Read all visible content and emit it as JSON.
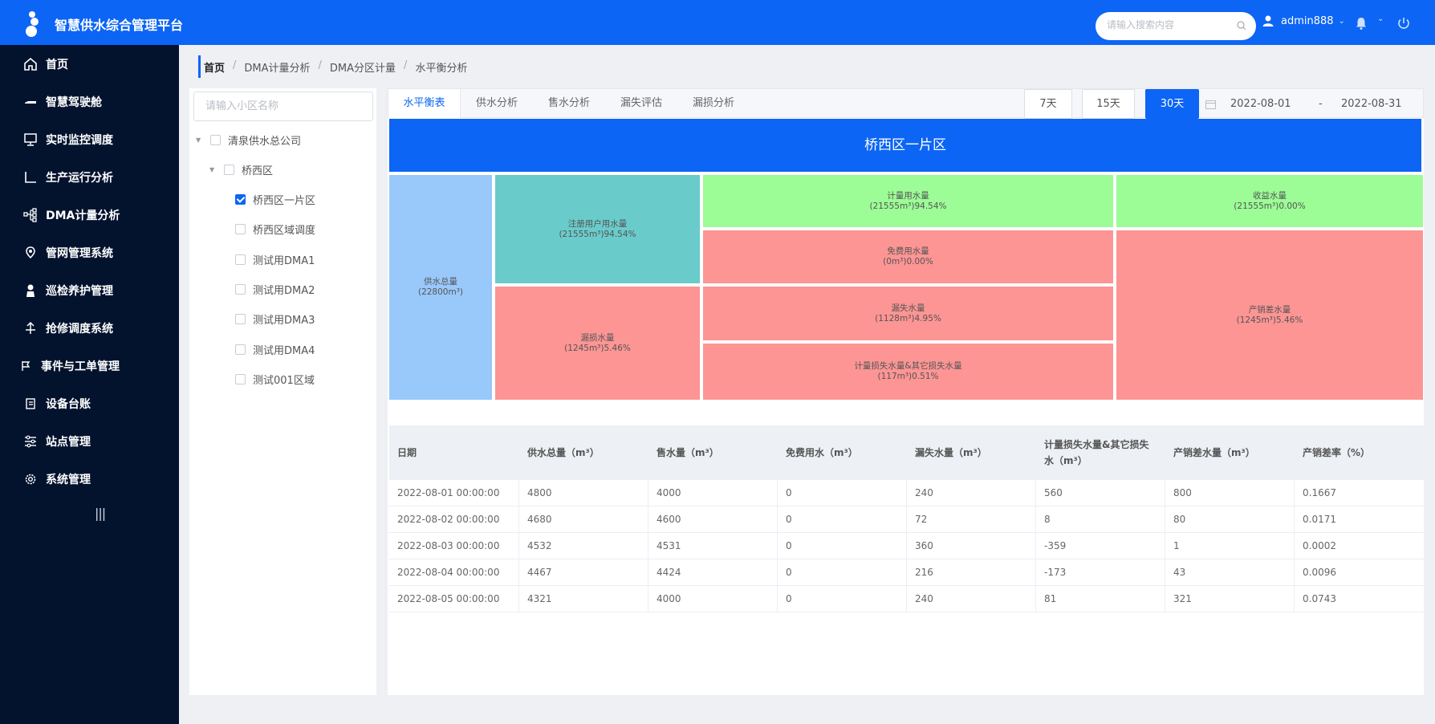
{
  "app": {
    "title": "智慧供水综合管理平台"
  },
  "header": {
    "search_placeholder": "请输入搜索内容",
    "username": "admin888"
  },
  "sidebar": {
    "items": [
      {
        "label": "首页",
        "icon": "home-icon"
      },
      {
        "label": "智慧驾驶舱",
        "icon": "cockpit-icon"
      },
      {
        "label": "实时监控调度",
        "icon": "monitor-icon"
      },
      {
        "label": "生产运行分析",
        "icon": "chart-axis-icon"
      },
      {
        "label": "DMA计量分析",
        "icon": "flow-tree-icon"
      },
      {
        "label": "管网管理系统",
        "icon": "map-pin-icon"
      },
      {
        "label": "巡检养护管理",
        "icon": "worker-icon"
      },
      {
        "label": "抢修调度系统",
        "icon": "repair-icon"
      },
      {
        "label": "事件与工单管理",
        "icon": "event-icon"
      },
      {
        "label": "设备台账",
        "icon": "ledger-icon"
      },
      {
        "label": "站点管理",
        "icon": "sliders-icon"
      },
      {
        "label": "系统管理",
        "icon": "gear-icon"
      }
    ],
    "collapse_label": "|||"
  },
  "breadcrumb": [
    "首页",
    "DMA计量分析",
    "DMA分区计量",
    "水平衡分析"
  ],
  "left_panel": {
    "search_placeholder": "请输入小区名称",
    "tree": [
      {
        "label": "清泉供水总公司",
        "checked": false
      },
      {
        "label": "桥西区",
        "checked": false
      },
      {
        "label": "桥西区一片区",
        "checked": true
      },
      {
        "label": "桥西区域调度",
        "checked": false
      },
      {
        "label": "测试用DMA1",
        "checked": false
      },
      {
        "label": "测试用DMA2",
        "checked": false
      },
      {
        "label": "测试用DMA3",
        "checked": false
      },
      {
        "label": "测试用DMA4",
        "checked": false
      },
      {
        "label": "测试001区域",
        "checked": false
      }
    ]
  },
  "tabs": [
    "水平衡表",
    "供水分析",
    "售水分析",
    "漏失评估",
    "漏损分析"
  ],
  "active_tab": "水平衡表",
  "ranges": [
    "7天",
    "15天",
    "30天"
  ],
  "active_range": "30天",
  "date_range": {
    "start": "2022-08-01",
    "separator": "-",
    "end": "2022-08-31"
  },
  "balance": {
    "region_title": "桥西区一片区",
    "total_supply": {
      "label": "供水总量",
      "value": "(22800m³)"
    },
    "registered_use": {
      "label": "注册用户用水量",
      "value": "(21555m³)94.54%"
    },
    "loss": {
      "label": "漏损水量",
      "value": "(1245m³)5.46%"
    },
    "metered_use": {
      "label": "计量用水量",
      "value": "(21555m³)94.54%"
    },
    "free_use": {
      "label": "免费用水量",
      "value": "(0m³)0.00%"
    },
    "leakage": {
      "label": "漏失水量",
      "value": "(1128m³)4.95%"
    },
    "meter_loss": {
      "label": "计量损失水量&其它损失水量",
      "value": "(117m³)0.51%"
    },
    "revenue": {
      "label": "收益水量",
      "value": "(21555m³)0.00%"
    },
    "non_revenue": {
      "label": "产销差水量",
      "value": "(1245m³)5.46%"
    },
    "colors": {
      "supply": "#99c8fb",
      "registered": "#6acbcb",
      "good": "#9cfc96",
      "loss": "#fc9594"
    }
  },
  "table": {
    "headers": [
      "日期",
      "供水总量（m³）",
      "售水量（m³）",
      "免费用水（m³）",
      "漏失水量（m³）",
      "计量损失水量&其它损失水（m³）",
      "产销差水量（m³）",
      "产销差率（%）"
    ],
    "rows": [
      [
        "2022-08-01 00:00:00",
        "4800",
        "4000",
        "0",
        "240",
        "560",
        "800",
        "0.1667"
      ],
      [
        "2022-08-02 00:00:00",
        "4680",
        "4600",
        "0",
        "72",
        "8",
        "80",
        "0.0171"
      ],
      [
        "2022-08-03 00:00:00",
        "4532",
        "4531",
        "0",
        "360",
        "-359",
        "1",
        "0.0002"
      ],
      [
        "2022-08-04 00:00:00",
        "4467",
        "4424",
        "0",
        "216",
        "-173",
        "43",
        "0.0096"
      ],
      [
        "2022-08-05 00:00:00",
        "4321",
        "4000",
        "0",
        "240",
        "81",
        "321",
        "0.0743"
      ]
    ]
  },
  "accent_color": "#0c65f5"
}
